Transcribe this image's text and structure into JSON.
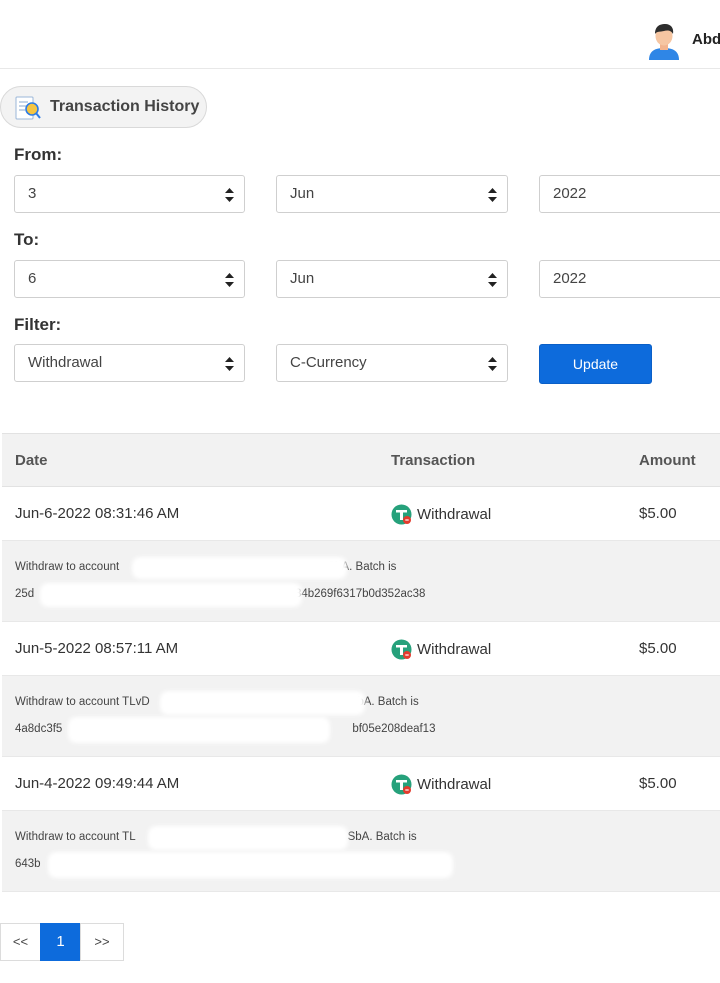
{
  "header": {
    "username": "Abd"
  },
  "page": {
    "title": "Transaction History"
  },
  "form": {
    "from_label": "From:",
    "to_label": "To:",
    "filter_label": "Filter:",
    "from_day": "3",
    "from_month": "Jun",
    "from_year": "2022",
    "to_day": "6",
    "to_month": "Jun",
    "to_year": "2022",
    "filter_type": "Withdrawal",
    "filter_currency": "C-Currency",
    "update_label": "Update"
  },
  "table": {
    "col_date": "Date",
    "col_transaction": "Transaction",
    "col_amount": "Amount",
    "rows": [
      {
        "date": "Jun-6-2022 08:31:46 AM",
        "type": "Withdrawal",
        "amount": "$5.00",
        "detail1_a": "Withdraw to account ",
        "detail1_b": "SbA. Batch is",
        "detail2_a": "25d",
        "detail2_b": "c84b269f6317b0d352ac38"
      },
      {
        "date": "Jun-5-2022 08:57:11 AM",
        "type": "Withdrawal",
        "amount": "$5.00",
        "detail1_a": "Withdraw to account TLvD",
        "detail1_b": "SbA. Batch is",
        "detail2_a": "4a8dc3f5",
        "detail2_b": "bf05e208deaf13"
      },
      {
        "date": "Jun-4-2022 09:49:44 AM",
        "type": "Withdrawal",
        "amount": "$5.00",
        "detail1_a": "Withdraw to account TL",
        "detail1_b": "SbA. Batch is",
        "detail2_a": "643b",
        "detail2_b": ""
      }
    ]
  },
  "pagination": {
    "prev": "<<",
    "current": "1",
    "next": ">>"
  },
  "colors": {
    "primary": "#0d6bdc",
    "tether": "#26a17b"
  },
  "icons": {
    "avatar": "user-avatar-icon",
    "title": "transaction-search-icon",
    "coin": "tether-coin-icon",
    "select": "select-arrows-icon"
  }
}
